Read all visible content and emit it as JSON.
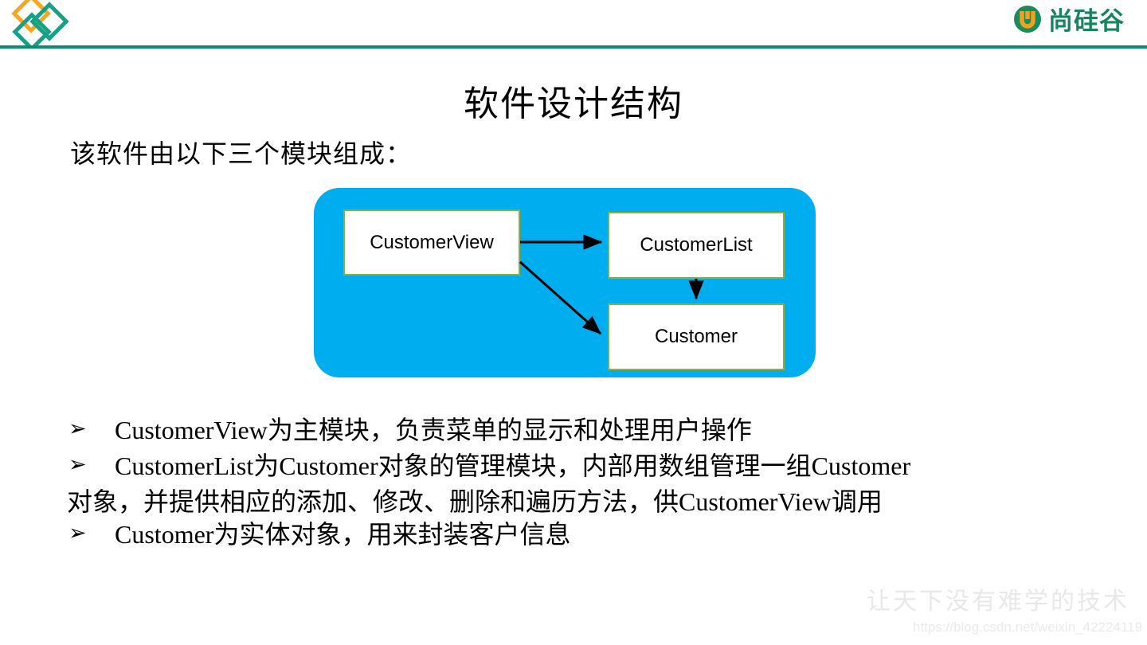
{
  "header": {
    "diamond_logo_icon": "diamond-trio-icon",
    "diamond_colors": {
      "orange": "#F5A623",
      "teal": "#16A085"
    },
    "rule_color": "#0E8C72",
    "brand": {
      "mark_icon": "u-circle-icon",
      "mark_colors": {
        "ring": "#1A8A5F",
        "letter": "#F0A11E"
      },
      "name": "尚硅谷"
    }
  },
  "slide": {
    "title": "软件设计结构",
    "intro": "该软件由以下三个模块组成："
  },
  "diagram": {
    "container_color": "#00ADEF",
    "node_border_color": "#8FAE39",
    "nodes": [
      {
        "id": "customer-view",
        "label": "CustomerView"
      },
      {
        "id": "customer-list",
        "label": "CustomerList"
      },
      {
        "id": "customer",
        "label": "Customer"
      }
    ],
    "arrows": [
      {
        "from": "CustomerView",
        "to": "CustomerList"
      },
      {
        "from": "CustomerView",
        "to": "Customer"
      },
      {
        "from": "CustomerList",
        "to": "Customer"
      }
    ]
  },
  "bullets": [
    {
      "marker": "➢",
      "text": "CustomerView为主模块，负责菜单的显示和处理用户操作",
      "continuation": ""
    },
    {
      "marker": "➢",
      "text": "CustomerList为Customer对象的管理模块，内部用数组管理一组Customer",
      "continuation": "对象，并提供相应的添加、修改、删除和遍历方法，供CustomerView调用"
    },
    {
      "marker": "➢",
      "text": "Customer为实体对象，用来封装客户信息",
      "continuation": ""
    }
  ],
  "watermark": {
    "slogan": "让天下没有难学的技术",
    "url": "https://blog.csdn.net/weixin_42224119"
  }
}
